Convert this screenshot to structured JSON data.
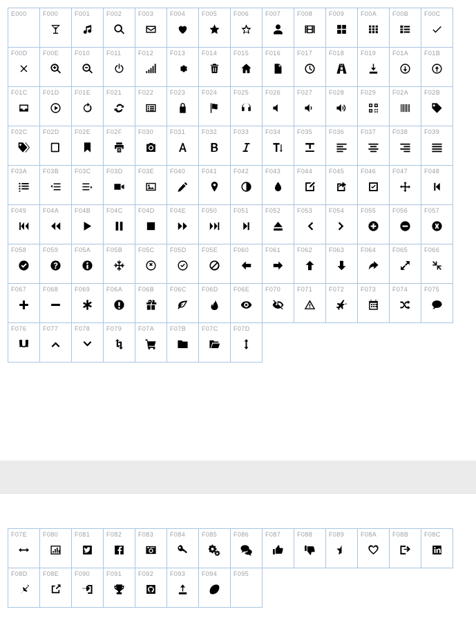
{
  "page": {
    "title": "Icon Font Glyph Cheatsheet",
    "background_color": "#ffffff",
    "grid_border_color": "#a8c4e0",
    "code_text_color": "#9aa0a6",
    "glyph_color": "#000000",
    "band_color": "#ebebeb",
    "columns": 14
  },
  "band": {
    "label": "",
    "visible": true
  },
  "tables": [
    {
      "name": "primary-glyph-table",
      "rows": [
        [
          {
            "code": "E000",
            "icon": "blank-icon"
          },
          {
            "code": "F000",
            "icon": "martini-glass-icon"
          },
          {
            "code": "F001",
            "icon": "music-note-icon"
          },
          {
            "code": "F002",
            "icon": "search-icon"
          },
          {
            "code": "F003",
            "icon": "envelope-icon"
          },
          {
            "code": "F004",
            "icon": "heart-filled-icon"
          },
          {
            "code": "F005",
            "icon": "star-filled-icon"
          },
          {
            "code": "F006",
            "icon": "star-outline-icon"
          },
          {
            "code": "F007",
            "icon": "user-icon"
          },
          {
            "code": "F008",
            "icon": "film-icon"
          },
          {
            "code": "F009",
            "icon": "grid-large-icon"
          },
          {
            "code": "F00A",
            "icon": "grid-small-icon"
          },
          {
            "code": "F00B",
            "icon": "list-blocks-icon"
          },
          {
            "code": "F00C",
            "icon": "check-icon"
          }
        ],
        [
          {
            "code": "F00D",
            "icon": "times-icon"
          },
          {
            "code": "F00E",
            "icon": "search-plus-icon"
          },
          {
            "code": "F010",
            "icon": "search-minus-icon"
          },
          {
            "code": "F011",
            "icon": "power-off-icon"
          },
          {
            "code": "F012",
            "icon": "signal-icon"
          },
          {
            "code": "F013",
            "icon": "gear-icon"
          },
          {
            "code": "F014",
            "icon": "trash-icon"
          },
          {
            "code": "F015",
            "icon": "home-icon"
          },
          {
            "code": "F016",
            "icon": "file-icon"
          },
          {
            "code": "F017",
            "icon": "clock-icon"
          },
          {
            "code": "F018",
            "icon": "road-icon"
          },
          {
            "code": "F019",
            "icon": "download-icon"
          },
          {
            "code": "F01A",
            "icon": "arrow-circle-down-icon"
          },
          {
            "code": "F01B",
            "icon": "arrow-circle-up-icon"
          }
        ],
        [
          {
            "code": "F01C",
            "icon": "inbox-icon"
          },
          {
            "code": "F01D",
            "icon": "play-circle-icon"
          },
          {
            "code": "F01E",
            "icon": "rotate-right-icon"
          },
          {
            "code": "F021",
            "icon": "refresh-icon"
          },
          {
            "code": "F022",
            "icon": "list-alt-icon"
          },
          {
            "code": "F023",
            "icon": "lock-icon"
          },
          {
            "code": "F024",
            "icon": "flag-icon"
          },
          {
            "code": "F025",
            "icon": "headphones-icon"
          },
          {
            "code": "F026",
            "icon": "volume-off-icon"
          },
          {
            "code": "F027",
            "icon": "volume-down-icon"
          },
          {
            "code": "F028",
            "icon": "volume-up-icon"
          },
          {
            "code": "F029",
            "icon": "qrcode-icon"
          },
          {
            "code": "F02A",
            "icon": "barcode-icon"
          },
          {
            "code": "F02B",
            "icon": "tag-icon"
          }
        ],
        [
          {
            "code": "F02C",
            "icon": "tags-icon"
          },
          {
            "code": "F02D",
            "icon": "book-icon"
          },
          {
            "code": "F02E",
            "icon": "bookmark-icon"
          },
          {
            "code": "F02F",
            "icon": "print-icon"
          },
          {
            "code": "F030",
            "icon": "camera-icon"
          },
          {
            "code": "F031",
            "icon": "font-icon"
          },
          {
            "code": "F032",
            "icon": "bold-icon"
          },
          {
            "code": "F033",
            "icon": "italic-icon"
          },
          {
            "code": "F034",
            "icon": "text-height-icon"
          },
          {
            "code": "F035",
            "icon": "text-width-icon"
          },
          {
            "code": "F036",
            "icon": "align-left-icon"
          },
          {
            "code": "F037",
            "icon": "align-center-icon"
          },
          {
            "code": "F038",
            "icon": "align-right-icon"
          },
          {
            "code": "F039",
            "icon": "align-justify-icon"
          }
        ],
        [
          {
            "code": "F03A",
            "icon": "list-icon"
          },
          {
            "code": "F03B",
            "icon": "indent-decrease-icon"
          },
          {
            "code": "F03C",
            "icon": "indent-increase-icon"
          },
          {
            "code": "F03D",
            "icon": "video-camera-icon"
          },
          {
            "code": "F03E",
            "icon": "picture-icon"
          },
          {
            "code": "F040",
            "icon": "pencil-icon"
          },
          {
            "code": "F041",
            "icon": "map-marker-icon"
          },
          {
            "code": "F042",
            "icon": "adjust-icon"
          },
          {
            "code": "F043",
            "icon": "tint-icon"
          },
          {
            "code": "F044",
            "icon": "edit-square-icon"
          },
          {
            "code": "F045",
            "icon": "share-square-icon"
          },
          {
            "code": "F046",
            "icon": "check-square-icon"
          },
          {
            "code": "F047",
            "icon": "arrows-move-icon"
          },
          {
            "code": "F048",
            "icon": "step-backward-icon"
          }
        ],
        [
          {
            "code": "F049",
            "icon": "fast-backward-icon"
          },
          {
            "code": "F04A",
            "icon": "backward-icon"
          },
          {
            "code": "F04B",
            "icon": "play-icon"
          },
          {
            "code": "F04C",
            "icon": "pause-icon"
          },
          {
            "code": "F04D",
            "icon": "stop-icon"
          },
          {
            "code": "F04E",
            "icon": "forward-icon"
          },
          {
            "code": "F050",
            "icon": "fast-forward-icon"
          },
          {
            "code": "F051",
            "icon": "step-forward-icon"
          },
          {
            "code": "F052",
            "icon": "eject-icon"
          },
          {
            "code": "F053",
            "icon": "chevron-left-icon"
          },
          {
            "code": "F054",
            "icon": "chevron-right-icon"
          },
          {
            "code": "F055",
            "icon": "plus-circle-icon"
          },
          {
            "code": "F056",
            "icon": "minus-circle-icon"
          },
          {
            "code": "F057",
            "icon": "times-circle-icon"
          }
        ],
        [
          {
            "code": "F058",
            "icon": "check-circle-icon"
          },
          {
            "code": "F059",
            "icon": "question-circle-icon"
          },
          {
            "code": "F05A",
            "icon": "info-circle-icon"
          },
          {
            "code": "F05B",
            "icon": "crosshairs-icon"
          },
          {
            "code": "F05C",
            "icon": "times-circle-outline-icon"
          },
          {
            "code": "F05D",
            "icon": "check-circle-outline-icon"
          },
          {
            "code": "F05E",
            "icon": "ban-icon"
          },
          {
            "code": "F060",
            "icon": "arrow-left-icon"
          },
          {
            "code": "F061",
            "icon": "arrow-right-icon"
          },
          {
            "code": "F062",
            "icon": "arrow-up-icon"
          },
          {
            "code": "F063",
            "icon": "arrow-down-icon"
          },
          {
            "code": "F064",
            "icon": "share-icon"
          },
          {
            "code": "F065",
            "icon": "expand-icon"
          },
          {
            "code": "F066",
            "icon": "compress-icon"
          }
        ],
        [
          {
            "code": "F067",
            "icon": "plus-icon"
          },
          {
            "code": "F068",
            "icon": "minus-icon"
          },
          {
            "code": "F069",
            "icon": "asterisk-icon"
          },
          {
            "code": "F06A",
            "icon": "exclamation-circle-icon"
          },
          {
            "code": "F06B",
            "icon": "gift-icon"
          },
          {
            "code": "F06C",
            "icon": "leaf-icon"
          },
          {
            "code": "F06D",
            "icon": "fire-icon"
          },
          {
            "code": "F06E",
            "icon": "eye-icon"
          },
          {
            "code": "F070",
            "icon": "eye-slash-icon"
          },
          {
            "code": "F071",
            "icon": "warning-triangle-icon"
          },
          {
            "code": "F072",
            "icon": "plane-icon"
          },
          {
            "code": "F073",
            "icon": "calendar-icon"
          },
          {
            "code": "F074",
            "icon": "random-icon"
          },
          {
            "code": "F075",
            "icon": "comment-icon"
          }
        ],
        [
          {
            "code": "F076",
            "icon": "magnet-icon"
          },
          {
            "code": "F077",
            "icon": "chevron-up-icon"
          },
          {
            "code": "F078",
            "icon": "chevron-down-icon"
          },
          {
            "code": "F079",
            "icon": "retweet-icon"
          },
          {
            "code": "F07A",
            "icon": "shopping-cart-icon"
          },
          {
            "code": "F07B",
            "icon": "folder-closed-icon"
          },
          {
            "code": "F07C",
            "icon": "folder-open-icon"
          },
          {
            "code": "F07D",
            "icon": "arrows-vertical-icon"
          }
        ]
      ]
    },
    {
      "name": "secondary-glyph-table",
      "rows": [
        [
          {
            "code": "F07E",
            "icon": "arrows-horizontal-icon"
          },
          {
            "code": "F080",
            "icon": "bar-chart-icon"
          },
          {
            "code": "F081",
            "icon": "twitter-square-icon"
          },
          {
            "code": "F082",
            "icon": "facebook-square-icon"
          },
          {
            "code": "F083",
            "icon": "camera-retro-icon"
          },
          {
            "code": "F084",
            "icon": "key-icon"
          },
          {
            "code": "F085",
            "icon": "cogs-icon"
          },
          {
            "code": "F086",
            "icon": "comments-icon"
          },
          {
            "code": "F087",
            "icon": "thumbs-up-icon"
          },
          {
            "code": "F088",
            "icon": "thumbs-down-icon"
          },
          {
            "code": "F089",
            "icon": "star-half-icon"
          },
          {
            "code": "F08A",
            "icon": "heart-outline-icon"
          },
          {
            "code": "F08B",
            "icon": "sign-out-icon"
          },
          {
            "code": "F08C",
            "icon": "linkedin-square-icon"
          }
        ],
        [
          {
            "code": "F08D",
            "icon": "thumbtack-icon"
          },
          {
            "code": "F08E",
            "icon": "external-link-icon"
          },
          {
            "code": "F090",
            "icon": "sign-in-icon"
          },
          {
            "code": "F091",
            "icon": "trophy-icon"
          },
          {
            "code": "F092",
            "icon": "github-square-icon"
          },
          {
            "code": "F093",
            "icon": "upload-icon"
          },
          {
            "code": "F094",
            "icon": "lemon-icon"
          },
          {
            "code": "F095",
            "icon": "blank-icon"
          }
        ]
      ]
    }
  ]
}
